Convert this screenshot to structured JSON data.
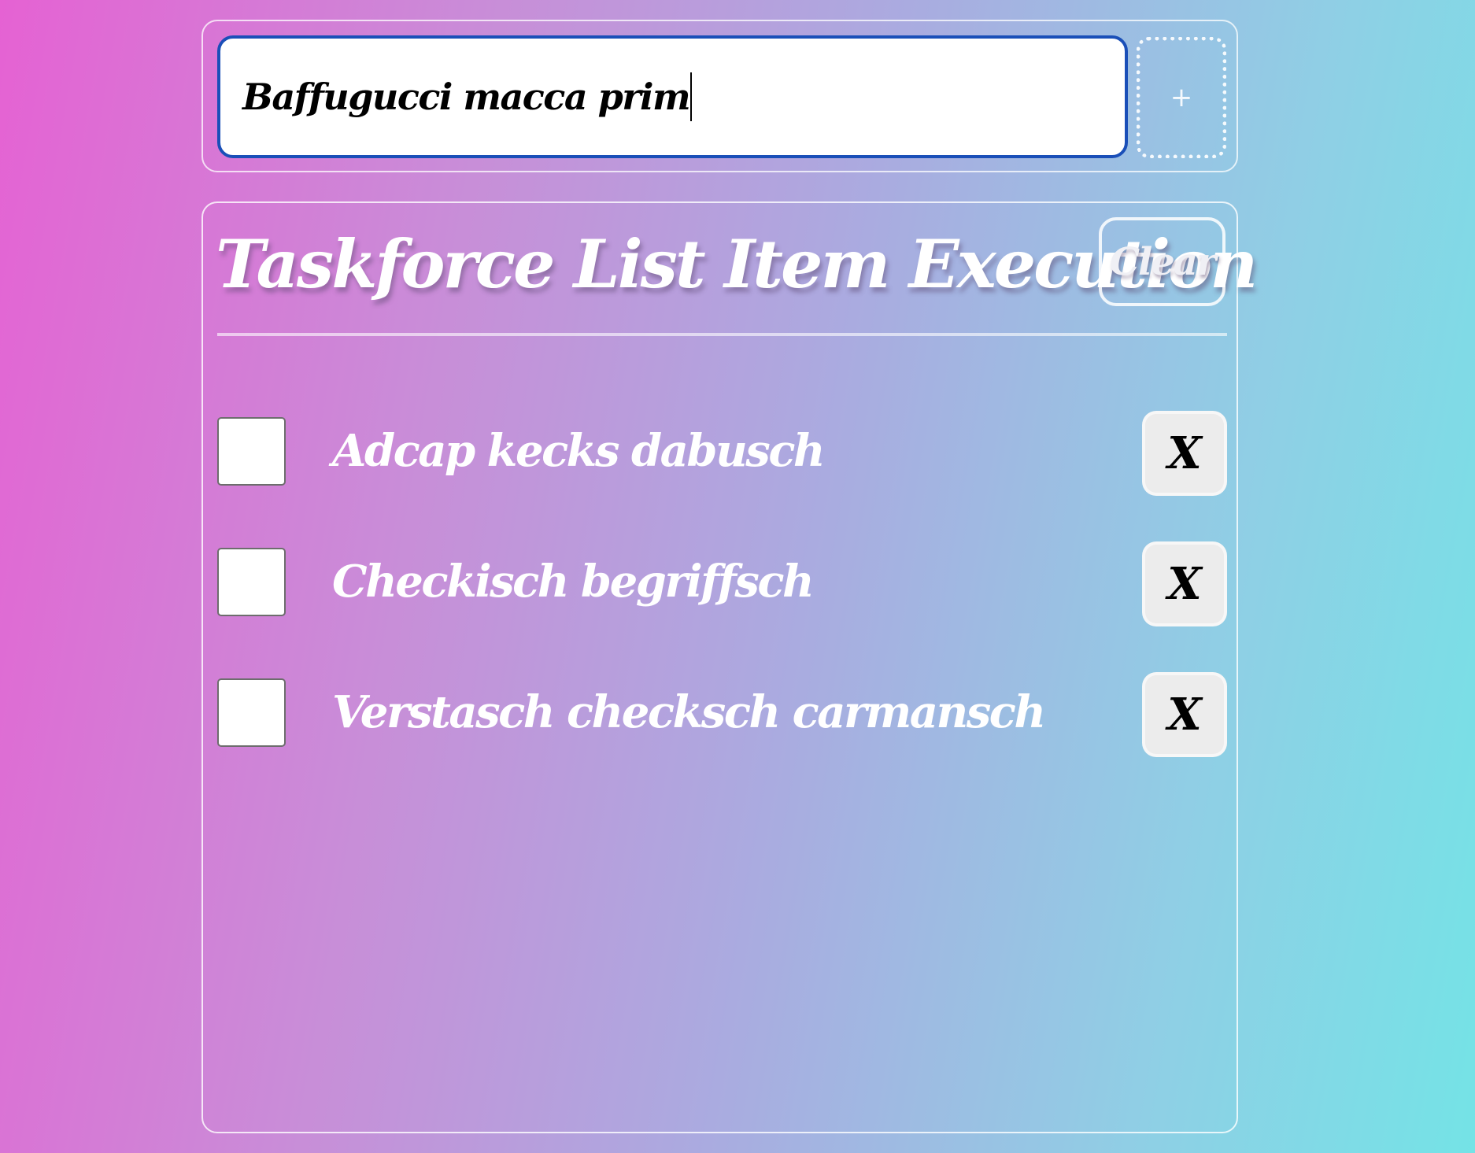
{
  "new_task": {
    "value": "Baffugucci macca prim",
    "add_label": "+"
  },
  "list": {
    "title": "Taskforce List Item Execution",
    "clear_label": "Clear",
    "items": [
      {
        "label": "Adcap kecks dabusch",
        "checked": false,
        "delete_label": "X"
      },
      {
        "label": "Checkisch begriffsch",
        "checked": false,
        "delete_label": "X"
      },
      {
        "label": "Verstasch checksch carmansch",
        "checked": false,
        "delete_label": "X"
      }
    ]
  },
  "colors": {
    "background_start": "#e562d3",
    "background_end": "#74e3e6",
    "input_focus_border": "#1a4fb8",
    "delete_button_bg": "#ececec"
  }
}
